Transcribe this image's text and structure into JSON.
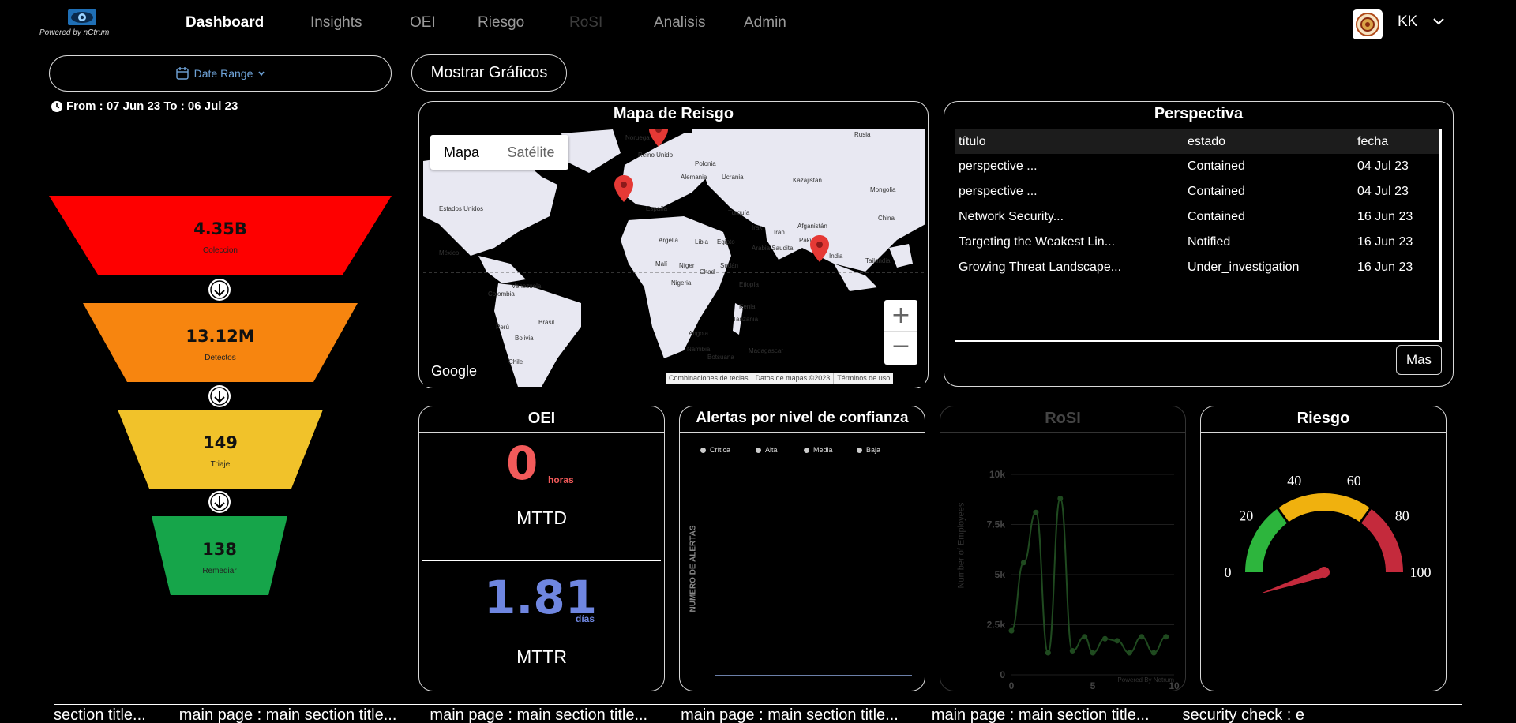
{
  "logo": {
    "powered_by": "Powered by  nCtrum"
  },
  "nav": {
    "items": [
      {
        "label": "Dashboard",
        "state": "active"
      },
      {
        "label": "Insights",
        "state": "normal"
      },
      {
        "label": "OEI",
        "state": "normal"
      },
      {
        "label": "Riesgo",
        "state": "normal"
      },
      {
        "label": "RoSI",
        "state": "disabled"
      },
      {
        "label": "Analisis",
        "state": "normal"
      },
      {
        "label": "Admin",
        "state": "normal"
      }
    ]
  },
  "user": {
    "initials": "KK"
  },
  "date_range": {
    "button_label": "Date Range",
    "text": "From : 07 Jun 23 To : 06 Jul 23"
  },
  "funnel": [
    {
      "value": "4.35B",
      "label": "Coleccion",
      "color": "#fe0000"
    },
    {
      "value": "13.12M",
      "label": "Detectos",
      "color": "#f7850f"
    },
    {
      "value": "149",
      "label": "Triaje",
      "color": "#f1c22a"
    },
    {
      "value": "138",
      "label": "Remediar",
      "color": "#16a54a"
    }
  ],
  "mostrar_button": "Mostrar Gráficos",
  "map_panel": {
    "title": "Mapa de Reisgo",
    "toggle": [
      "Mapa",
      "Satélite"
    ],
    "google": "Google",
    "footer": [
      "Combinaciones de teclas",
      "Datos de mapas ©2023",
      "Términos de uso"
    ],
    "zoom_in": "+",
    "zoom_out": "−",
    "labels": [
      "Noruega",
      "Rusia",
      "Reino Unido",
      "Polonia",
      "Alemania",
      "Ucrania",
      "Kazajistán",
      "Mongolia",
      "Estados Unidos",
      "España",
      "Turquía",
      "Afganistán",
      "China",
      "Irak",
      "Irán",
      "Pakistán",
      "Argelia",
      "Libia",
      "Egipto",
      "Arabia Saudita",
      "India",
      "Tailandia",
      "México",
      "Malí",
      "Níger",
      "Chad",
      "Sudán",
      "Nigeria",
      "Etiopía",
      "Venezuela",
      "Colombia",
      "Kenia",
      "Tanzania",
      "Perú",
      "Brasil",
      "Angola",
      "Bolivia",
      "Namibia",
      "Botsuana",
      "Madagascar",
      "Chile"
    ]
  },
  "perspectiva": {
    "title": "Perspectiva",
    "headers": [
      "título",
      "estado",
      "fecha"
    ],
    "rows": [
      [
        "perspective ...",
        "Contained",
        "04 Jul 23"
      ],
      [
        "perspective ...",
        "Contained",
        "04 Jul 23"
      ],
      [
        "Network Security...",
        "Contained",
        "16 Jun 23"
      ],
      [
        "Targeting the Weakest Lin...",
        "Notified",
        "16 Jun 23"
      ],
      [
        "Growing Threat Landscape...",
        "Under_investigation",
        "16 Jun 23"
      ]
    ],
    "more_button": "Mas"
  },
  "oei": {
    "title": "OEI",
    "mttd_value": "0",
    "mttd_unit": "horas",
    "mttd_label": "MTTD",
    "mttr_value": "1.81",
    "mttr_unit": "días",
    "mttr_label": "MTTR",
    "colors": {
      "mttd": "#f25a5a",
      "mttr": "#6f86e0"
    }
  },
  "alertas": {
    "title": "Alertas por nivel de confianza",
    "legend": [
      "Crítica",
      "Alta",
      "Media",
      "Baja"
    ],
    "ylabel": "NUMERO DE ALERTAS"
  },
  "rosi": {
    "title": "RoSI",
    "ylabel": "Number of Employees",
    "credit": "Powered By Netrum",
    "chart_data": {
      "type": "line",
      "x": [
        0,
        0.75,
        1.5,
        2.25,
        3,
        3.75,
        4.5,
        5,
        5.75,
        6.5,
        7.25,
        8,
        8.75,
        9.5
      ],
      "y": [
        2200,
        5600,
        8100,
        1100,
        8800,
        1200,
        1900,
        1100,
        1800,
        1700,
        1100,
        1900,
        1100,
        1900
      ],
      "xticks": [
        "0",
        "5",
        "10"
      ],
      "yticks": [
        "0",
        "2.5k",
        "5k",
        "7.5k",
        "10k"
      ],
      "xlim": [
        0,
        10
      ],
      "ylim": [
        0,
        10000
      ]
    }
  },
  "riesgo": {
    "title": "Riesgo",
    "ticks": [
      "0",
      "20",
      "40",
      "60",
      "80",
      "100"
    ],
    "value": 4,
    "colors": {
      "green": "#2db53d",
      "yellow": "#f0b10e",
      "red": "#c42a3c",
      "needle": "#c42a3c"
    }
  },
  "ticker": {
    "items": [
      "section title...",
      "main page : main section title...",
      "main page : main section title...",
      "main page : main section title...",
      "main page : main section title...",
      "security check : e"
    ]
  }
}
